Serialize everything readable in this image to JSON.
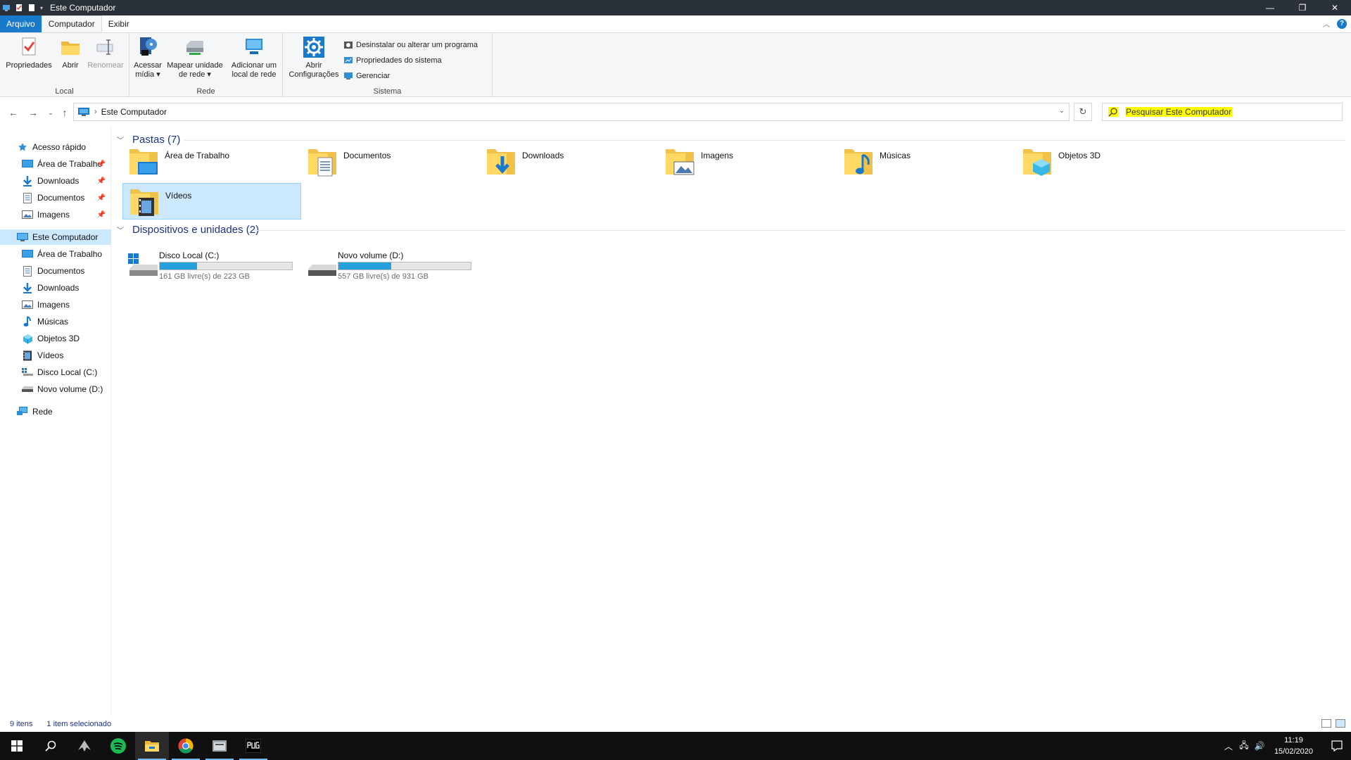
{
  "window": {
    "title": "Este Computador"
  },
  "ribbon": {
    "tabs": [
      "Arquivo",
      "Computador",
      "Exibir"
    ],
    "groups": {
      "local": {
        "label": "Local",
        "buttons": [
          {
            "label1": "Propriedades",
            "label2": "",
            "icon": "properties-icon"
          },
          {
            "label1": "Abrir",
            "label2": "",
            "icon": "open-folder-icon"
          },
          {
            "label1": "Renomear",
            "label2": "",
            "icon": "rename-icon"
          }
        ]
      },
      "rede": {
        "label": "Rede",
        "buttons": [
          {
            "label1": "Acessar",
            "label2": "mídia ▾",
            "icon": "media-icon"
          },
          {
            "label1": "Mapear unidade",
            "label2": "de rede ▾",
            "icon": "map-drive-icon"
          },
          {
            "label1": "Adicionar um",
            "label2": "local de rede",
            "icon": "add-network-location-icon"
          }
        ]
      },
      "sistema": {
        "label": "Sistema",
        "big_button": {
          "label1": "Abrir",
          "label2": "Configurações",
          "icon": "settings-gear-icon"
        },
        "small_buttons": [
          "Desinstalar ou alterar um programa",
          "Propriedades do sistema",
          "Gerenciar"
        ]
      }
    }
  },
  "address": {
    "location": "Este Computador",
    "search_placeholder": "Pesquisar Este Computador"
  },
  "nav": {
    "quick_access": "Acesso rápido",
    "quick_items": [
      "Área de Trabalho",
      "Downloads",
      "Documentos",
      "Imagens"
    ],
    "this_pc": "Este Computador",
    "pc_items": [
      "Área de Trabalho",
      "Documentos",
      "Downloads",
      "Imagens",
      "Músicas",
      "Objetos 3D",
      "Vídeos",
      "Disco Local (C:)",
      "Novo volume (D:)"
    ],
    "network": "Rede"
  },
  "content": {
    "folders_header": "Pastas (7)",
    "folders": [
      "Área de Trabalho",
      "Documentos",
      "Downloads",
      "Imagens",
      "Músicas",
      "Objetos 3D",
      "Vídeos"
    ],
    "drives_header": "Dispositivos e unidades (2)",
    "drives": [
      {
        "name": "Disco Local (C:)",
        "size": "161 GB livre(s) de 223 GB",
        "used_fraction": 0.28
      },
      {
        "name": "Novo volume (D:)",
        "size": "557 GB livre(s) de 931 GB",
        "used_fraction": 0.4
      }
    ]
  },
  "status": {
    "count": "9 itens",
    "selected": "1 item selecionado"
  },
  "taskbar": {
    "time": "11:19",
    "date": "15/02/2020"
  },
  "colors": {
    "accent": "#1979ca",
    "selection": "#cce8ff",
    "header_blue": "#1e3287",
    "drive_bar": "#26a0da"
  }
}
